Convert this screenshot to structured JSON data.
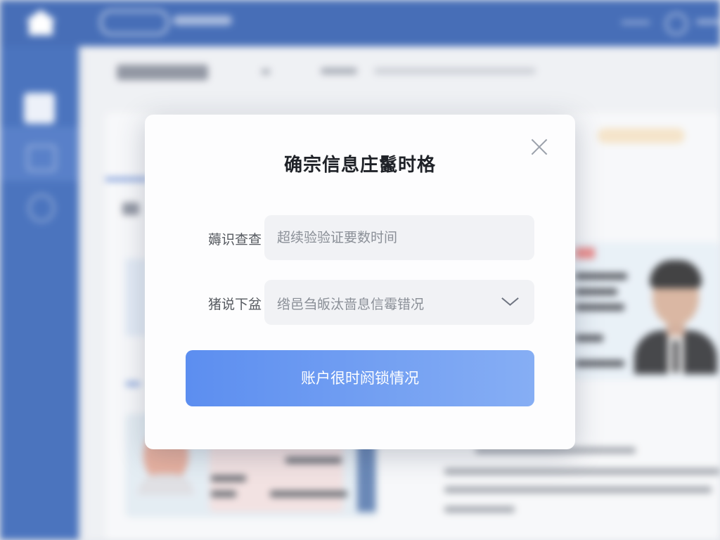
{
  "modal": {
    "title": "确宗信息庄鬣时格",
    "fields": [
      {
        "label": "薅识查查",
        "placeholder": "超续验验证要数时间"
      },
      {
        "label": "猪说下盆",
        "value": "绺邑刍皈汰啬息信霉错况"
      }
    ],
    "button_label": "账户很时阏锁情况"
  },
  "icons": {
    "close": "close-icon",
    "dropdown": "chevron-down-icon",
    "home": "home-icon"
  },
  "colors": {
    "topbar": "#1f4fa8",
    "sidebar": "#2456b0",
    "button_start": "#5c8ef0",
    "button_end": "#86aef4"
  }
}
